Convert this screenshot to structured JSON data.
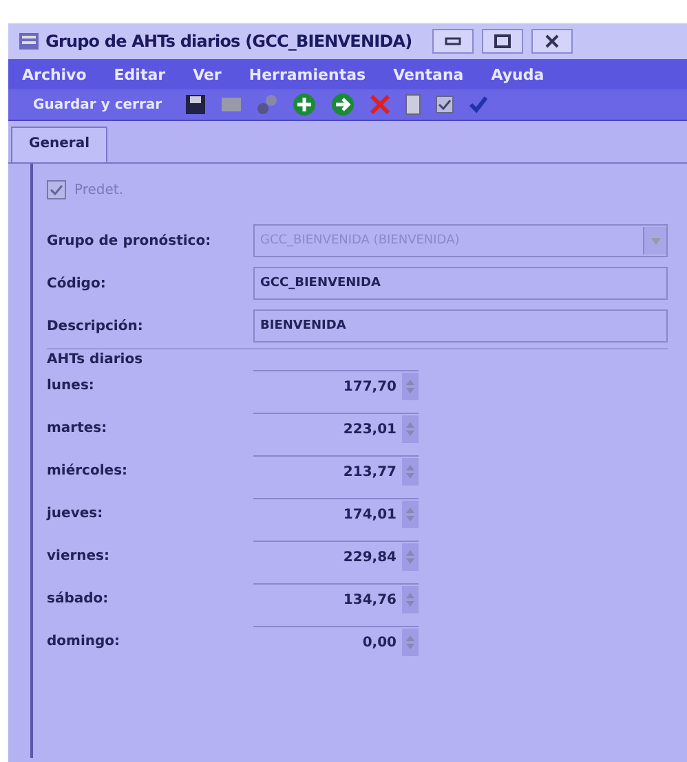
{
  "window": {
    "title": "Grupo de AHTs diarios (GCC_BIENVENIDA)"
  },
  "menu": [
    "Archivo",
    "Editar",
    "Ver",
    "Herramientas",
    "Ventana",
    "Ayuda"
  ],
  "toolbar": {
    "save_close": "Guardar y cerrar"
  },
  "tabs": [
    {
      "label": "General",
      "selected": true
    }
  ],
  "default_checkbox": {
    "label": "Predet.",
    "checked": true,
    "disabled": true
  },
  "fields": [
    {
      "label": "Grupo de pronóstico:",
      "value": "GCC_BIENVENIDA (BIENVENIDA)",
      "kind": "combo",
      "disabled": true
    },
    {
      "label": "Código:",
      "value": "GCC_BIENVENIDA",
      "kind": "text",
      "disabled": false
    },
    {
      "label": "Descripción:",
      "value": "BIENVENIDA",
      "kind": "text",
      "disabled": false
    }
  ],
  "section": "AHTs diarios",
  "days": [
    {
      "label": "lunes:",
      "value": "177,70"
    },
    {
      "label": "martes:",
      "value": "223,01"
    },
    {
      "label": "miércoles:",
      "value": "213,77"
    },
    {
      "label": "jueves:",
      "value": "174,01"
    },
    {
      "label": "viernes:",
      "value": "229,84"
    },
    {
      "label": "sábado:",
      "value": "134,76"
    },
    {
      "label": "domingo:",
      "value": "0,00"
    }
  ]
}
